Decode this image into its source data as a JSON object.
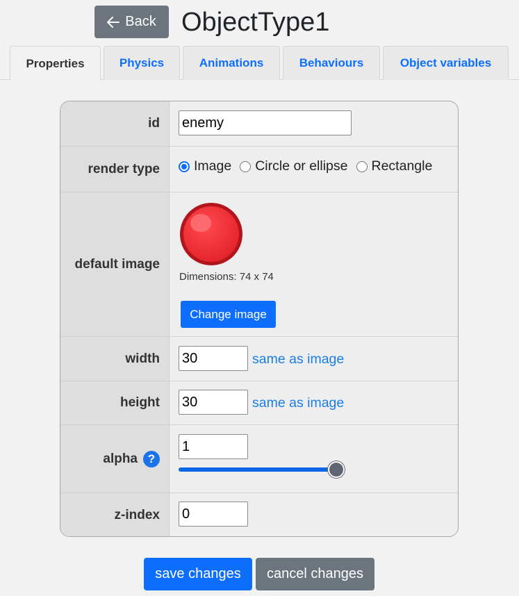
{
  "header": {
    "back_label": "Back",
    "back_icon": "arrow-left-icon",
    "title": "ObjectType1"
  },
  "tabs": [
    {
      "label": "Properties",
      "active": true
    },
    {
      "label": "Physics",
      "active": false
    },
    {
      "label": "Animations",
      "active": false
    },
    {
      "label": "Behaviours",
      "active": false
    },
    {
      "label": "Object variables",
      "active": false
    }
  ],
  "properties": {
    "id": {
      "label": "id",
      "value": "enemy"
    },
    "render_type": {
      "label": "render type",
      "options": [
        "Image",
        "Circle or ellipse",
        "Rectangle"
      ],
      "selected": "Image"
    },
    "default_image": {
      "label": "default image",
      "image": "red-ball-image",
      "dimensions_text": "Dimensions: 74 x 74",
      "change_label": "Change image"
    },
    "width": {
      "label": "width",
      "value": "30",
      "link": "same as image"
    },
    "height": {
      "label": "height",
      "value": "30",
      "link": "same as image"
    },
    "alpha": {
      "label": "alpha",
      "value": "1",
      "help_icon": "?",
      "slider_fraction": 1.0
    },
    "z_index": {
      "label": "z-index",
      "value": "0"
    }
  },
  "footer": {
    "save_label": "save changes",
    "cancel_label": "cancel changes"
  },
  "colors": {
    "primary": "#0d6efd",
    "secondary": "#6c757d",
    "link": "#1a7ee6",
    "ball": "#e8282e"
  }
}
